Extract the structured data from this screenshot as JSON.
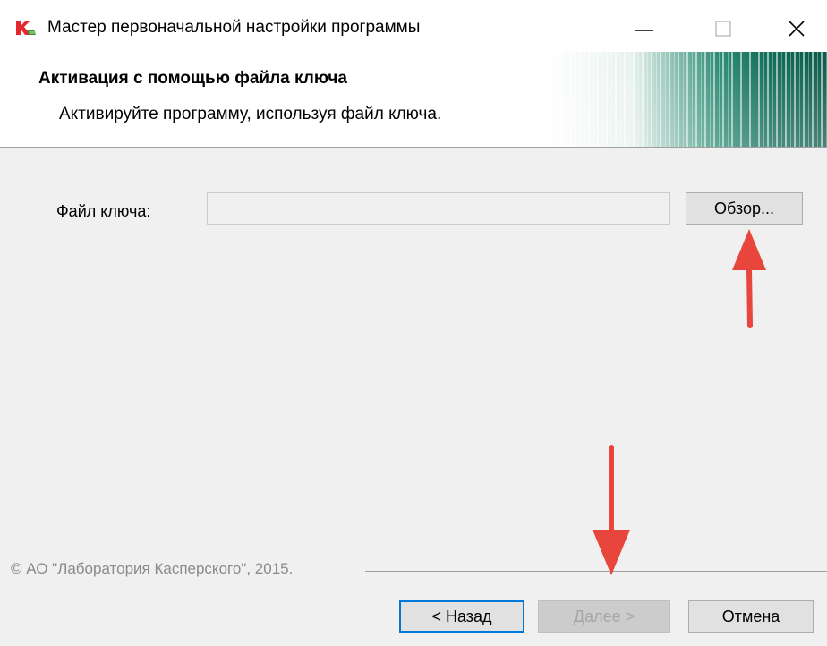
{
  "window": {
    "title": "Мастер первоначальной настройки программы",
    "controls": [
      "minimize-icon",
      "maximize-icon",
      "close-icon"
    ]
  },
  "header": {
    "title": "Активация с помощью файла ключа",
    "subtitle": "Активируйте программу, используя файл ключа."
  },
  "form": {
    "key_file_label": "Файл ключа:",
    "key_file_value": "",
    "browse_label": "Обзор..."
  },
  "footer": {
    "copyright": "© АО \"Лаборатория Касперского\", 2015.",
    "back_label": "< Назад",
    "next_label": "Далее >",
    "cancel_label": "Отмена",
    "next_enabled": false
  },
  "annotations": {
    "arrow_color": "#e8453c",
    "arrows": [
      "arrow-up-to-browse",
      "arrow-down-to-next"
    ]
  },
  "colors": {
    "brand_accent": "#0b6a55",
    "logo_red": "#e4282b",
    "focus_border": "#0078d7"
  }
}
